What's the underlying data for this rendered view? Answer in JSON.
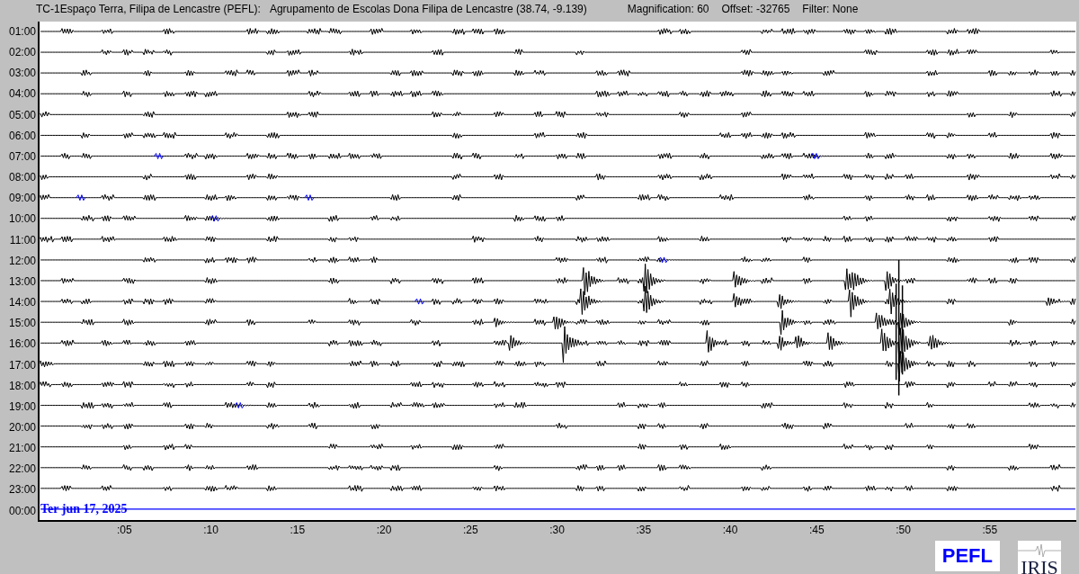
{
  "header": {
    "station": "TC-1Espaço Terra, Filipa de Lencastre (PEFL):",
    "location": "Agrupamento de Escolas Dona Filipa de Lencastre (38.74, -9.139)",
    "magnification": "Magnification: 60",
    "offset": "Offset: -32765",
    "filter": "Filter: None"
  },
  "helicorder": {
    "hours": [
      "01:00",
      "02:00",
      "03:00",
      "04:00",
      "05:00",
      "06:00",
      "07:00",
      "08:00",
      "09:00",
      "10:00",
      "11:00",
      "12:00",
      "13:00",
      "14:00",
      "15:00",
      "16:00",
      "17:00",
      "18:00",
      "19:00",
      "20:00",
      "21:00",
      "22:00",
      "23:00",
      "00:00"
    ],
    "date": "Ter jun 17, 2025",
    "minute_ticks": [
      ":05",
      ":10",
      ":15",
      ":20",
      ":25",
      ":30",
      ":35",
      ":40",
      ":45",
      ":50",
      ":55"
    ]
  },
  "logos": {
    "station": "PEFL",
    "network": "IRIS"
  }
}
